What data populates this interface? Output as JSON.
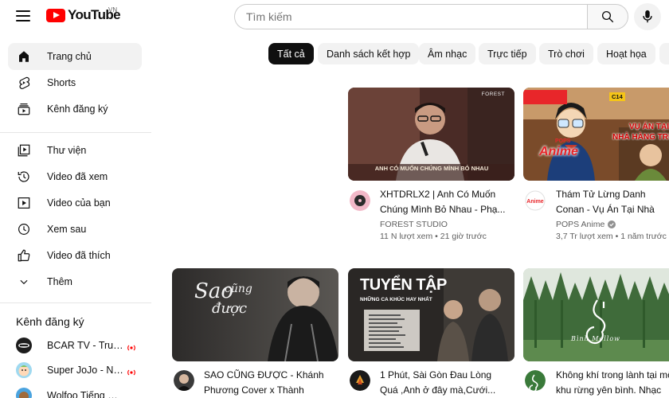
{
  "header": {
    "logo_text": "YouTube",
    "country": "VN",
    "search_placeholder": "Tìm kiếm"
  },
  "sidebar": {
    "items": [
      {
        "label": "Trang chủ",
        "icon": "home-icon"
      },
      {
        "label": "Shorts",
        "icon": "shorts-icon"
      },
      {
        "label": "Kênh đăng ký",
        "icon": "subscriptions-icon"
      },
      {
        "label": "Thư viện",
        "icon": "library-icon"
      },
      {
        "label": "Video đã xem",
        "icon": "history-icon"
      },
      {
        "label": "Video của bạn",
        "icon": "your-videos-icon"
      },
      {
        "label": "Xem sau",
        "icon": "watch-later-icon"
      },
      {
        "label": "Video đã thích",
        "icon": "like-icon"
      },
      {
        "label": "Thêm",
        "icon": "chevron-down-icon"
      }
    ],
    "subscriptions_heading": "Kênh đăng ký",
    "subscriptions": [
      {
        "label": "BCAR TV - Truyề..."
      },
      {
        "label": "Super JoJo - Nh..."
      },
      {
        "label": "Wolfoo Tiếng Việ..."
      }
    ]
  },
  "chips": [
    "Tất cả",
    "Danh sách kết hợp",
    "Âm nhạc",
    "Trực tiếp",
    "Trò chơi",
    "Hoạt họa"
  ],
  "videos": [
    {
      "title": "XHTDRLX2 | Anh Có Muốn Chúng Mình Bỏ Nhau - Phạ...",
      "channel": "FOREST STUDIO",
      "views": "11 N lượt xem",
      "age": "21 giờ trước",
      "thumb_brand": "FOREST",
      "thumb_caption": "ANH CÓ MUỐN CHÚNG MÌNH BỎ NHAU"
    },
    {
      "title": "Thám Tử Lừng Danh Conan - Vụ Án Tại Nhà Hàng Trung...",
      "channel": "POPS Anime",
      "views": "3,7 Tr lượt xem",
      "age": "1 năm trước",
      "thumb_caption1": "VỤ ÁN TẠI",
      "thumb_caption2": "NHÀ HÀNG TRUNG",
      "thumb_brand": "Anime",
      "thumb_brand_small": "POPS",
      "thumb_tag": "C14"
    },
    {
      "title": "SAO CŨNG ĐƯỢC - Khánh Phương Cover x Thành Đạt|...",
      "thumb_script1": "Sao",
      "thumb_script2": "cũng",
      "thumb_script3": "được"
    },
    {
      "title": "1 Phút, Sài Gòn Đau Lòng Quá ,Anh ở đây mà,Cưới...",
      "thumb_heading": "TUYỂN TẬP",
      "thumb_sub": "NHỮNG CA KHÚC HAY NHẤT"
    },
    {
      "title": "Không khí trong lành tại mộ khu rừng yên bình. Nhạc tu...",
      "thumb_caption": "Bình Mellow"
    }
  ],
  "colors": {
    "brand_red": "#ff0000",
    "text": "#0f0f0f",
    "secondary_text": "#606060",
    "chip_bg": "#f2f2f2",
    "live_red": "#ff0000"
  }
}
